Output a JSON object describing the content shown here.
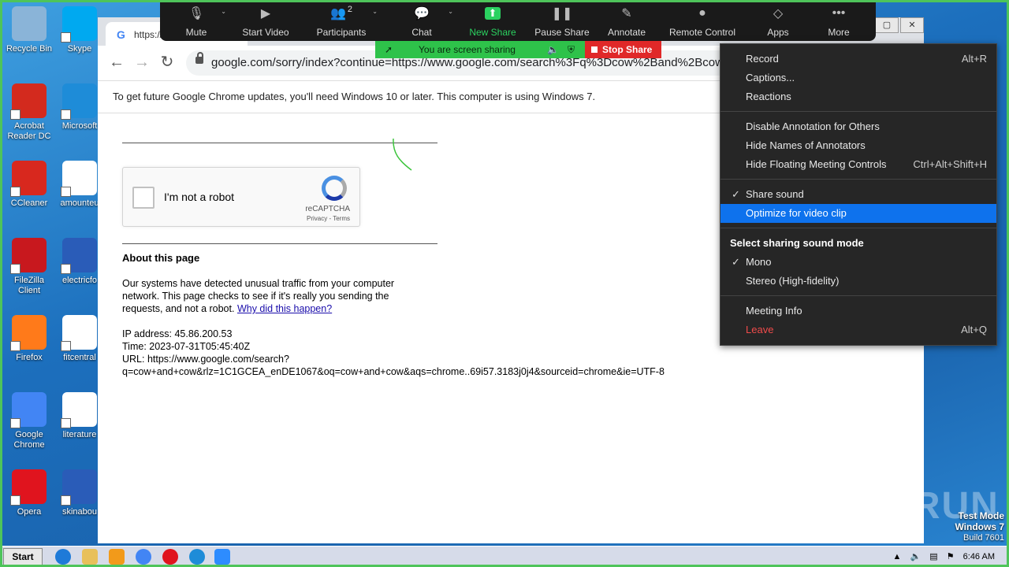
{
  "desktop": {
    "icons": [
      {
        "label": "Recycle Bin",
        "name": "recycle-bin-icon",
        "color": "#8ab4d8"
      },
      {
        "label": "Skype",
        "name": "skype-icon",
        "color": "#00a9f0"
      },
      {
        "label": "Acrobat Reader DC",
        "name": "acrobat-icon",
        "color": "#d32a1e"
      },
      {
        "label": "Microsoft",
        "name": "edge-icon",
        "color": "#1e8cd8"
      },
      {
        "label": "CCleaner",
        "name": "ccleaner-icon",
        "color": "#d8281e"
      },
      {
        "label": "amounteu",
        "name": "blank-file-icon",
        "color": "#ffffff"
      },
      {
        "label": "FileZilla Client",
        "name": "filezilla-icon",
        "color": "#c8181e"
      },
      {
        "label": "electricfo",
        "name": "word-doc-icon",
        "color": "#2a5cb8"
      },
      {
        "label": "Firefox",
        "name": "firefox-icon",
        "color": "#ff7a1a"
      },
      {
        "label": "fitcentral",
        "name": "blank-file-icon",
        "color": "#ffffff"
      },
      {
        "label": "Google Chrome",
        "name": "chrome-icon",
        "color": "#4285f4"
      },
      {
        "label": "literature",
        "name": "blank-file-icon",
        "color": "#ffffff"
      },
      {
        "label": "Opera",
        "name": "opera-icon",
        "color": "#e0141e"
      },
      {
        "label": "skinabou",
        "name": "word-doc-icon",
        "color": "#2a5cb8"
      }
    ]
  },
  "chrome": {
    "tab_title": "https://",
    "url": "google.com/sorry/index?continue=https://www.google.com/search%3Fq%3Dcow%2Band%2Bcow%26",
    "infobar": "To get future Google Chrome updates, you'll need Windows 10 or later. This computer is using Windows 7.",
    "captcha": {
      "label": "I'm not a robot",
      "brand": "reCAPTCHA",
      "links": "Privacy - Terms"
    },
    "about_title": "About this page",
    "para1": "Our systems have detected unusual traffic from your computer network. This page checks to see if it's really you sending the requests, and not a robot.",
    "para_link": "Why did this happen?",
    "ip": "IP address: 45.86.200.53",
    "time": "Time: 2023-07-31T05:45:40Z",
    "url_line1": "URL: https://www.google.com/search?",
    "url_line2": "q=cow+and+cow&rlz=1C1GCEA_enDE1067&oq=cow+and+cow&aqs=chrome..69i57.3183j0j4&sourceid=chrome&ie=UTF-8"
  },
  "zoom": {
    "buttons": [
      {
        "label": "Mute",
        "name": "mute-button",
        "icon": "microphone-icon"
      },
      {
        "label": "Start Video",
        "name": "start-video-button",
        "icon": "video-off-icon"
      },
      {
        "label": "Participants",
        "name": "participants-button",
        "icon": "participants-icon",
        "count": "2"
      },
      {
        "label": "Chat",
        "name": "chat-button",
        "icon": "chat-icon"
      },
      {
        "label": "New Share",
        "name": "new-share-button",
        "icon": "share-arrow-icon"
      },
      {
        "label": "Pause Share",
        "name": "pause-share-button",
        "icon": "pause-icon"
      },
      {
        "label": "Annotate",
        "name": "annotate-button",
        "icon": "pencil-icon"
      },
      {
        "label": "Remote Control",
        "name": "remote-control-button",
        "icon": "mouse-icon"
      },
      {
        "label": "Apps",
        "name": "apps-button",
        "icon": "apps-icon"
      },
      {
        "label": "More",
        "name": "more-button",
        "icon": "ellipsis-icon"
      }
    ],
    "sharing_text": "You are screen sharing",
    "stop_share": "Stop Share",
    "menu": {
      "record": "Record",
      "record_sc": "Alt+R",
      "captions": "Captions...",
      "reactions": "Reactions",
      "disable_annot": "Disable Annotation for Others",
      "hide_names": "Hide Names of Annotators",
      "hide_controls": "Hide Floating Meeting Controls",
      "hide_controls_sc": "Ctrl+Alt+Shift+H",
      "share_sound": "Share sound",
      "optimize": "Optimize for video clip",
      "sound_mode_header": "Select sharing sound mode",
      "mono": "Mono",
      "stereo": "Stereo (High-fidelity)",
      "meeting_info": "Meeting Info",
      "leave": "Leave",
      "leave_sc": "Alt+Q"
    }
  },
  "taskbar": {
    "start": "Start",
    "time": "6:46 AM"
  },
  "watermark": "ANY RUN",
  "testmode": {
    "line1": "Test Mode",
    "line2": "Windows 7",
    "line3": "Build 7601"
  }
}
